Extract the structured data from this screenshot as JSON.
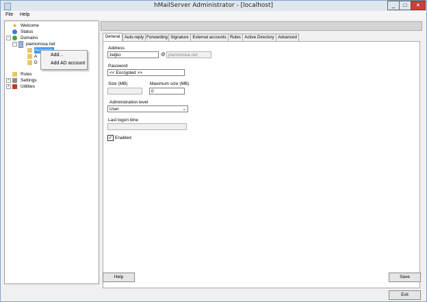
{
  "window": {
    "title": "hMailServer Administrator - [localhost]"
  },
  "menu": {
    "items": [
      "File",
      "Help"
    ]
  },
  "tree": {
    "welcome": "Welcome",
    "status": "Status",
    "domains": "Domains",
    "domain": "piamonosa.net",
    "accounts": "Accounts",
    "aliases_partial": "A",
    "dist_partial": "D",
    "rules": "Rules",
    "settings": "Settings",
    "utilities": "Utilities"
  },
  "context_menu": {
    "items": [
      "Add...",
      "Add AD account"
    ]
  },
  "tabs": [
    "General",
    "Auto-reply",
    "Forwarding",
    "Signature",
    "External accounts",
    "Rules",
    "Active Directory",
    "Advanced"
  ],
  "form": {
    "address_label": "Address",
    "address_value": "zeljko",
    "at": "@",
    "domain_value": "piamonosa.net",
    "password_label": "Password",
    "password_value": "<< Encrypted >>",
    "size_label": "Size (MB)",
    "size_value": "",
    "max_size_label": "Maximum size (MB)",
    "max_size_value": "0",
    "admin_level_label": "Administration level",
    "admin_level_value": "User",
    "last_logon_label": "Last logon time",
    "last_logon_value": "",
    "enabled_label": "Enabled",
    "enabled_checked": true
  },
  "buttons": {
    "help": "Help",
    "save": "Save",
    "exit": "Exit"
  }
}
